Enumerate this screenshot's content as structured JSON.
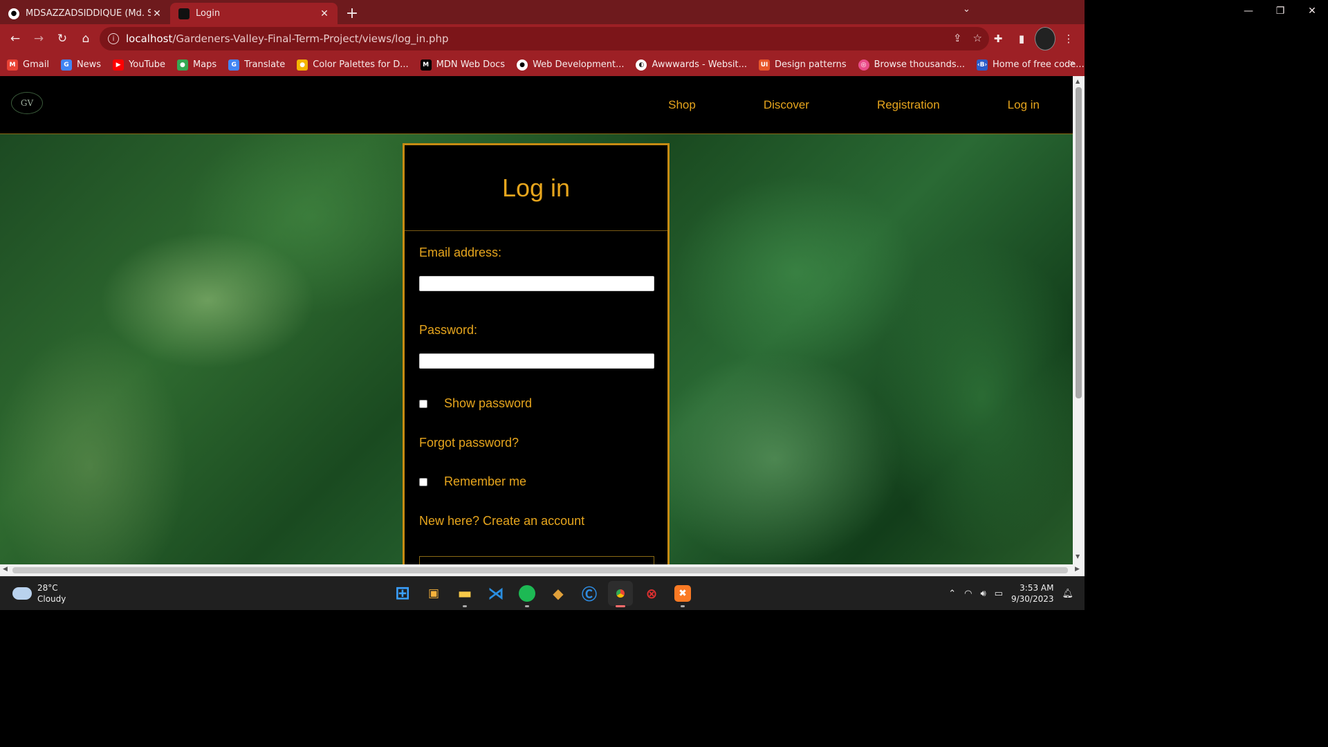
{
  "browser": {
    "tabs": [
      {
        "title": "MDSAZZADSIDDIQUE (Md. Sazzad",
        "icon": "github-icon",
        "active": false
      },
      {
        "title": "Login",
        "icon": "site-favicon",
        "active": true
      }
    ],
    "url_host": "localhost",
    "url_path": "/Gardeners-Valley-Final-Term-Project/views/log_in.php",
    "bookmarks": [
      {
        "label": "Gmail",
        "icon": "gmail-icon",
        "color": "#ea4335"
      },
      {
        "label": "News",
        "icon": "news-icon",
        "color": "#4285f4"
      },
      {
        "label": "YouTube",
        "icon": "youtube-icon",
        "color": "#ff0000"
      },
      {
        "label": "Maps",
        "icon": "maps-icon",
        "color": "#34a853"
      },
      {
        "label": "Translate",
        "icon": "translate-icon",
        "color": "#4285f4"
      },
      {
        "label": "Color Palettes for D...",
        "icon": "palette-icon",
        "color": "#f4b400"
      },
      {
        "label": "MDN Web Docs",
        "icon": "mdn-icon",
        "color": "#000000"
      },
      {
        "label": "Web Development...",
        "icon": "webdev-icon",
        "color": "#ffffff"
      },
      {
        "label": "Awwwards - Websit...",
        "icon": "awwwards-icon",
        "color": "#222222"
      },
      {
        "label": "Design patterns",
        "icon": "ui-icon",
        "color": "#e8562a"
      },
      {
        "label": "Browse thousands...",
        "icon": "dribbble-icon",
        "color": "#ea4c89"
      },
      {
        "label": "Home of free code...",
        "icon": "freecodecamp-icon",
        "color": "#2b5cc8"
      }
    ]
  },
  "site": {
    "logo_text": "GV",
    "nav": [
      "Shop",
      "Discover",
      "Registration",
      "Log in"
    ],
    "accent_color": "#e6a51d"
  },
  "login": {
    "title": "Log in",
    "email_label": "Email address:",
    "email_value": "",
    "password_label": "Password:",
    "password_value": "",
    "show_password_label": "Show password",
    "show_password_checked": false,
    "forgot_label": "Forgot password?",
    "remember_label": "Remember me",
    "remember_checked": false,
    "create_account_label": "New here? Create an account"
  },
  "taskbar": {
    "weather_temp": "28°C",
    "weather_desc": "Cloudy",
    "time": "3:53 AM",
    "date": "9/30/2023",
    "apps": [
      "windows-start-icon",
      "microsoft-pre-icon",
      "file-explorer-icon",
      "vscode-icon",
      "spotify-icon",
      "git-icon",
      "ccleaner-icon",
      "chrome-icon",
      "antivirus-icon",
      "xampp-icon"
    ]
  }
}
